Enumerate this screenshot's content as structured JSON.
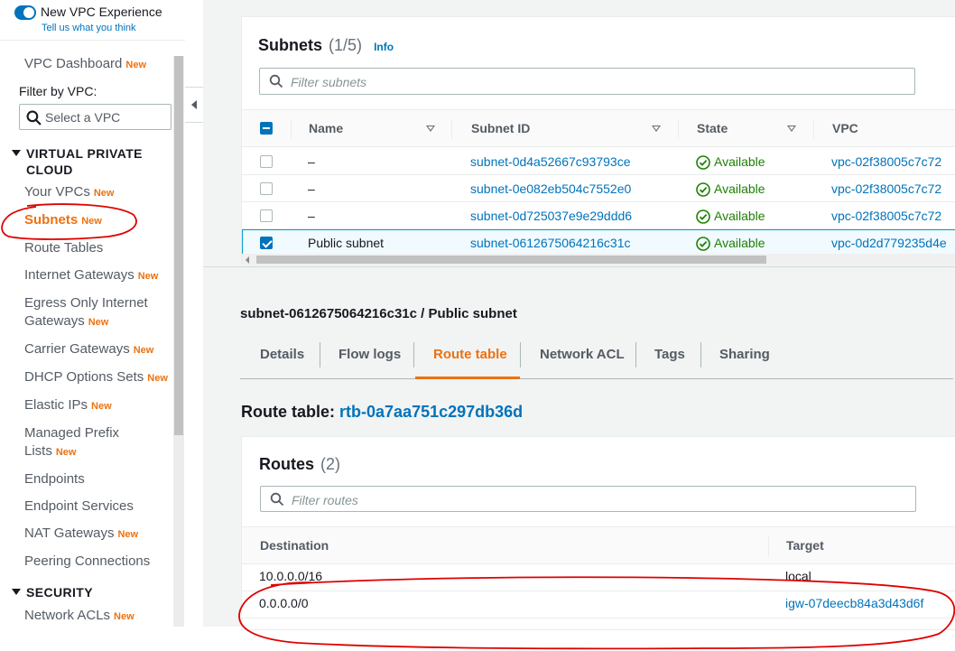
{
  "header": {
    "toggle_label": "New VPC Experience",
    "feedback_link": "Tell us what you think"
  },
  "sidebar": {
    "dashboard": {
      "label": "VPC Dashboard",
      "badge": "New"
    },
    "filter_label": "Filter by VPC:",
    "vpc_select_placeholder": "Select a VPC",
    "sections": [
      {
        "title_line1": "VIRTUAL PRIVATE",
        "title_line2": "CLOUD"
      },
      {
        "title": "SECURITY"
      }
    ],
    "items": [
      {
        "label": "Your VPCs",
        "badge": "New"
      },
      {
        "label": "Subnets",
        "badge": "New",
        "active": true
      },
      {
        "label": "Route Tables",
        "badge": ""
      },
      {
        "label": "Internet Gateways",
        "badge": "New"
      },
      {
        "label_line1": "Egress Only Internet",
        "label_line2": "Gateways",
        "badge": "New"
      },
      {
        "label": "Carrier Gateways",
        "badge": "New"
      },
      {
        "label": "DHCP Options Sets",
        "badge": "New"
      },
      {
        "label": "Elastic IPs",
        "badge": "New"
      },
      {
        "label_line1": "Managed Prefix",
        "label_line2": "Lists",
        "badge": "New"
      },
      {
        "label": "Endpoints",
        "badge": ""
      },
      {
        "label": "Endpoint Services",
        "badge": ""
      },
      {
        "label": "NAT Gateways",
        "badge": "New"
      },
      {
        "label": "Peering Connections",
        "badge": ""
      },
      {
        "label": "Network ACLs",
        "badge": "New"
      }
    ]
  },
  "subnets": {
    "title": "Subnets",
    "count": "(1/5)",
    "info": "Info",
    "filter_placeholder": "Filter subnets",
    "columns": [
      "Name",
      "Subnet ID",
      "State",
      "VPC"
    ],
    "rows": [
      {
        "name": "–",
        "subnet_id": "subnet-0d4a52667c93793ce",
        "state": "Available",
        "vpc": "vpc-02f38005c7c72",
        "selected": false
      },
      {
        "name": "–",
        "subnet_id": "subnet-0e082eb504c7552e0",
        "state": "Available",
        "vpc": "vpc-02f38005c7c72",
        "selected": false
      },
      {
        "name": "–",
        "subnet_id": "subnet-0d725037e9e29ddd6",
        "state": "Available",
        "vpc": "vpc-02f38005c7c72",
        "selected": false
      },
      {
        "name": "Public subnet",
        "subnet_id": "subnet-0612675064216c31c",
        "state": "Available",
        "vpc": "vpc-0d2d779235d4e",
        "selected": true
      }
    ]
  },
  "detail": {
    "title": "subnet-0612675064216c31c / Public subnet",
    "tabs": [
      "Details",
      "Flow logs",
      "Route table",
      "Network ACL",
      "Tags",
      "Sharing"
    ],
    "active_tab": "Route table",
    "route_table_label": "Route table:",
    "route_table_id": "rtb-0a7aa751c297db36d"
  },
  "routes": {
    "title": "Routes",
    "count": "(2)",
    "filter_placeholder": "Filter routes",
    "columns": [
      "Destination",
      "Target"
    ],
    "rows": [
      {
        "destination": "10.0.0.0/16",
        "target": "local",
        "target_is_link": false
      },
      {
        "destination": "0.0.0.0/0",
        "target": "igw-07deecb84a3d43d6f",
        "target_is_link": true
      }
    ]
  },
  "colors": {
    "accent_orange": "#ec7211",
    "link_blue": "#0073bb",
    "status_green": "#1d8102",
    "annotation_red": "#e00000"
  }
}
